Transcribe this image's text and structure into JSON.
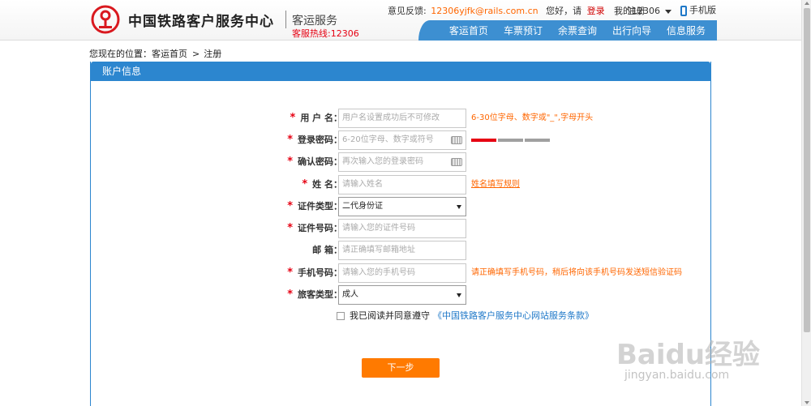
{
  "header": {
    "logo_icon": "railway-logo-icon",
    "site_title": "中国铁路客户服务中心",
    "site_subtitle": "客运服务",
    "hotline": "客服热线:12306",
    "feedback_label": "意见反馈:",
    "feedback_email": "12306yjfk@rails.com.cn",
    "greeting": "您好，请",
    "login_link": "登录",
    "separator": "|",
    "register_link": "注册",
    "my_account": "我的12306",
    "mobile_version": "手机版",
    "nav": [
      "客运首页",
      "车票预订",
      "余票查询",
      "出行向导",
      "信息服务"
    ]
  },
  "breadcrumb": {
    "prefix": "您现在的位置：",
    "home": "客运首页",
    "separator": ">",
    "current": "注册"
  },
  "panel": {
    "title": "账户信息"
  },
  "form": {
    "username": {
      "label": "用 户 名：",
      "placeholder": "用户名设置成功后不可修改",
      "hint": "6-30位字母、数字或\"_\",字母开头"
    },
    "password": {
      "label": "登录密码：",
      "placeholder": "6-20位字母、数字或符号",
      "strength_level": 1,
      "strength_max": 3
    },
    "confirm_password": {
      "label": "确认密码：",
      "placeholder": "再次输入您的登录密码"
    },
    "name": {
      "label": "姓 名：",
      "placeholder": "请输入姓名",
      "hint": "姓名填写规则"
    },
    "id_type": {
      "label": "证件类型：",
      "value": "二代身份证"
    },
    "id_number": {
      "label": "证件号码：",
      "placeholder": "请输入您的证件号码"
    },
    "email": {
      "label": "邮 箱：",
      "placeholder": "请正确填写邮箱地址"
    },
    "phone": {
      "label": "手机号码：",
      "placeholder": "请输入您的手机号码",
      "hint": "请正确填写手机号码，稍后将向该手机号码发送短信验证码"
    },
    "passenger_type": {
      "label": "旅客类型：",
      "value": "成人"
    },
    "required_mark": "*",
    "agree_text": "我已阅读并同意遵守",
    "agree_link": "《中国铁路客户服务中心网站服务条款》",
    "next_button": "下一步"
  },
  "watermark": {
    "main": "Baidu经验",
    "sub": "jingyan.baidu.com"
  },
  "colors": {
    "brand_blue": "#2c86cf",
    "nav_blue": "#3d8fd1",
    "required_red": "#e60012",
    "hint_orange": "#ff6600",
    "button_orange": "#ff7a00",
    "strength_active": "#e60012",
    "strength_inactive": "#a0a0a0"
  }
}
